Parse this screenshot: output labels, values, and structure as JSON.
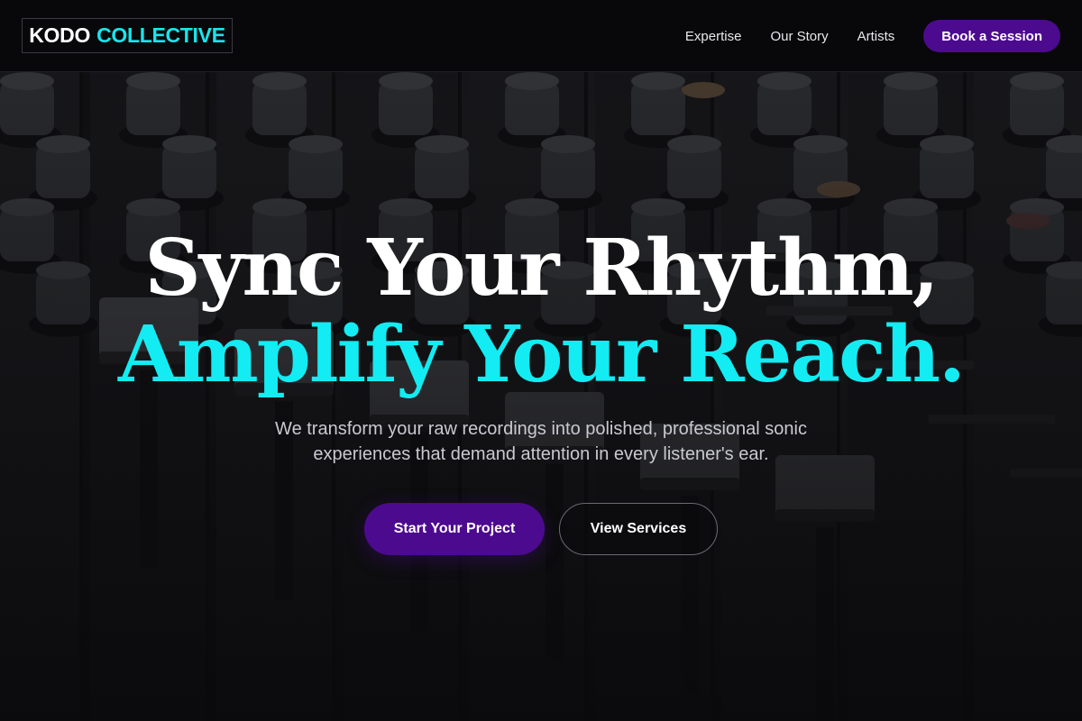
{
  "header": {
    "logo_primary": "KODO",
    "logo_accent": "COLLECTIVE",
    "nav": [
      {
        "label": "Expertise"
      },
      {
        "label": "Our Story"
      },
      {
        "label": "Artists"
      }
    ],
    "cta_label": "Book a Session"
  },
  "hero": {
    "title_line1": "Sync Your Rhythm,",
    "title_line2": "Amplify Your Reach.",
    "subtitle": "We transform your raw recordings into polished, professional sonic experiences that demand attention in every listener's ear.",
    "primary_button": "Start Your Project",
    "secondary_button": "View Services",
    "background_image": "mixing-console-image"
  },
  "colors": {
    "accent_cyan": "#12ecf2",
    "brand_purple": "#4c0a8f",
    "header_bg": "#08080a"
  }
}
